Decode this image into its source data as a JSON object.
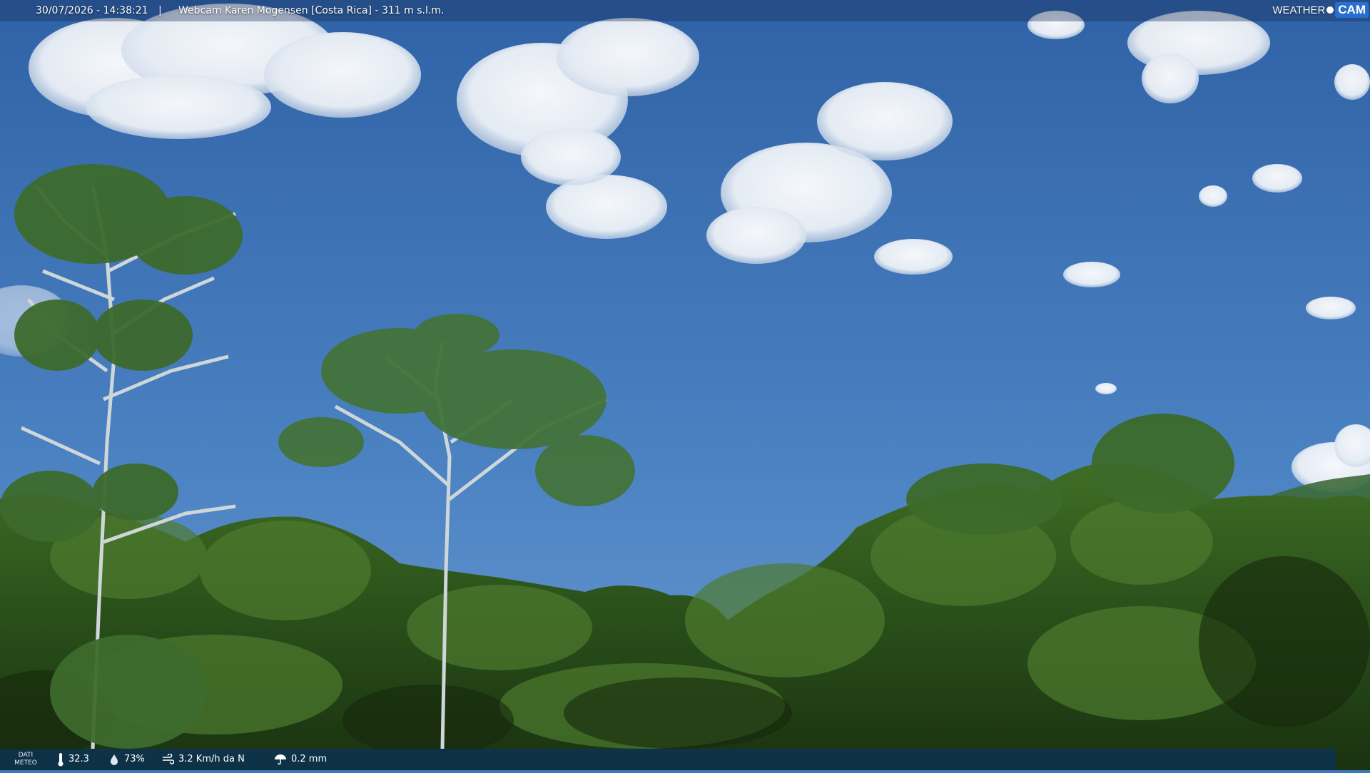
{
  "header": {
    "timestamp": "30/07/2026 - 14:38:21",
    "separator": "|",
    "title": "Webcam Karen Mogensen [Costa Rica]  - 311 m s.l.m.",
    "logo": {
      "weather_text": "WEATHER",
      "cam_text": "CAM"
    }
  },
  "footer": {
    "label_line1": "DATI",
    "label_line2": "METEO",
    "temperature": "32.3",
    "humidity": "73%",
    "wind": "3.2 Km/h da N",
    "rain": "0.2 mm"
  },
  "icons": {
    "temperature": "thermometer-icon",
    "humidity": "humidity-drop-icon",
    "wind": "wind-icon",
    "rain": "rain-umbrella-icon"
  },
  "colors": {
    "sky_top": "#2f62a6",
    "sky_bottom": "#6a9ad2",
    "foliage_dark": "#1f3f14",
    "foliage_mid": "#2f5a1e",
    "foliage_light": "#4d7a2e",
    "bar_bg": "#0a325a",
    "logo_accent": "#2a6fd0"
  }
}
